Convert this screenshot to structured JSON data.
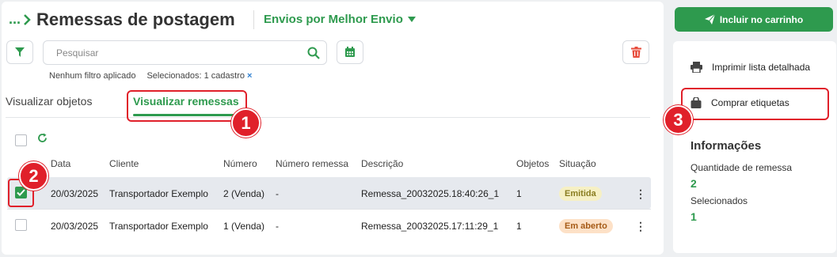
{
  "header": {
    "breadcrumb": "...",
    "title": "Remessas de postagem",
    "dropdown_label": "Envios por Melhor Envio"
  },
  "search": {
    "placeholder": "Pesquisar"
  },
  "filter_info": {
    "no_filter": "Nenhum filtro aplicado",
    "selected": "Selecionados: 1 cadastro",
    "clear": "×"
  },
  "tabs": [
    {
      "label": "Visualizar objetos"
    },
    {
      "label": "Visualizar remessas"
    }
  ],
  "table": {
    "columns": [
      "Data",
      "Cliente",
      "Número",
      "Número remessa",
      "Descrição",
      "Objetos",
      "Situação"
    ],
    "rows": [
      {
        "checked": true,
        "data": "20/03/2025",
        "cliente": "Transportador Exemplo",
        "numero": "2 (Venda)",
        "numero_remessa": "-",
        "descricao": "Remessa_20032025.18:40:26_1",
        "objetos": "1",
        "situacao": "Emitida"
      },
      {
        "checked": false,
        "data": "20/03/2025",
        "cliente": "Transportador Exemplo",
        "numero": "1 (Venda)",
        "numero_remessa": "-",
        "descricao": "Remessa_20032025.17:11:29_1",
        "objetos": "1",
        "situacao": "Em aberto"
      }
    ]
  },
  "sidebar": {
    "add_button": "Incluir no carrinho",
    "menu": [
      {
        "label": "Imprimir lista detalhada",
        "icon": "printer-icon"
      },
      {
        "label": "Comprar etiquetas",
        "icon": "bag-icon"
      }
    ],
    "info_title": "Informações",
    "info": [
      {
        "label": "Quantidade de remessa",
        "value": "2"
      },
      {
        "label": "Selecionados",
        "value": "1"
      }
    ]
  },
  "annotations": [
    "1",
    "2",
    "3"
  ],
  "colors": {
    "accent": "#2e9a4e",
    "annotation": "#e0202a",
    "delete": "#e74c3c"
  }
}
